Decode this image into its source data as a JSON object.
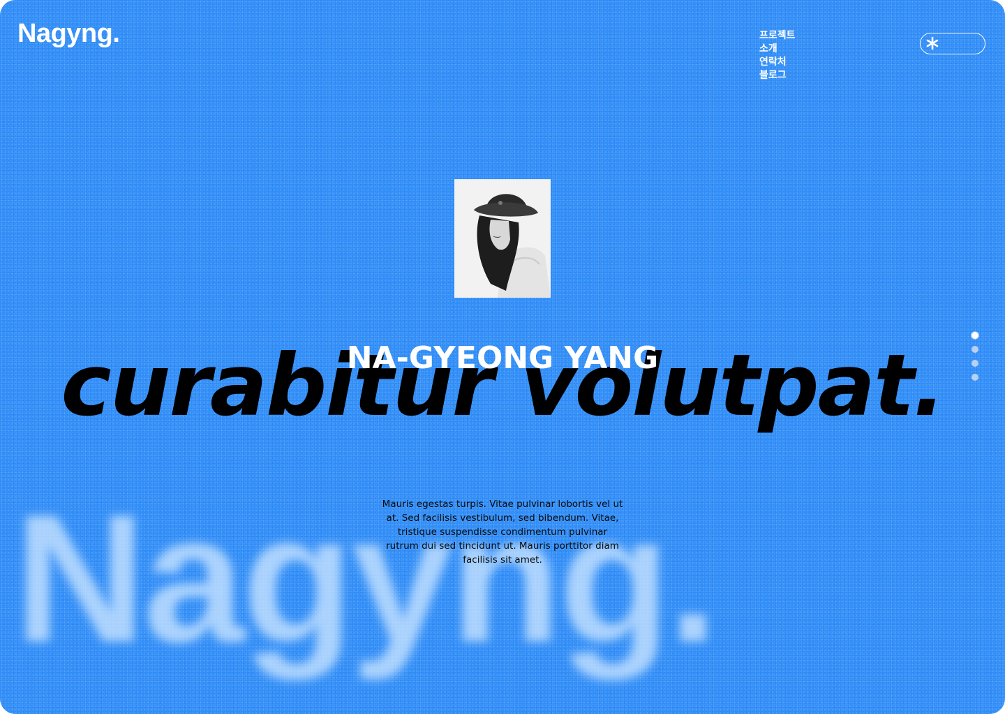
{
  "header": {
    "logo": "Nagyng."
  },
  "nav": {
    "items": [
      {
        "label": "프로젝트"
      },
      {
        "label": "소개"
      },
      {
        "label": "연락처"
      },
      {
        "label": "블로그"
      }
    ]
  },
  "menu_toggle": {
    "icon": "asterisk-icon"
  },
  "hero": {
    "portrait_alt": "Black and white portrait wearing a bucket hat",
    "name": "NA-GYEONG YANG",
    "headline": "curabitur volutpat.",
    "description": "Mauris egestas turpis. Vitae pulvinar lobortis vel ut at. Sed facilisis vestibulum, sed bibendum. Vitae, tristique suspendisse condimentum pulvinar rutrum dui sed tincidunt ut. Mauris porttitor diam facilisis sit amet.",
    "ghost_logo": "Nagyng."
  },
  "pagination": {
    "count": 4,
    "active_index": 0
  },
  "colors": {
    "background": "#2e8cf7",
    "text_primary": "#ffffff",
    "headline": "#000000"
  }
}
